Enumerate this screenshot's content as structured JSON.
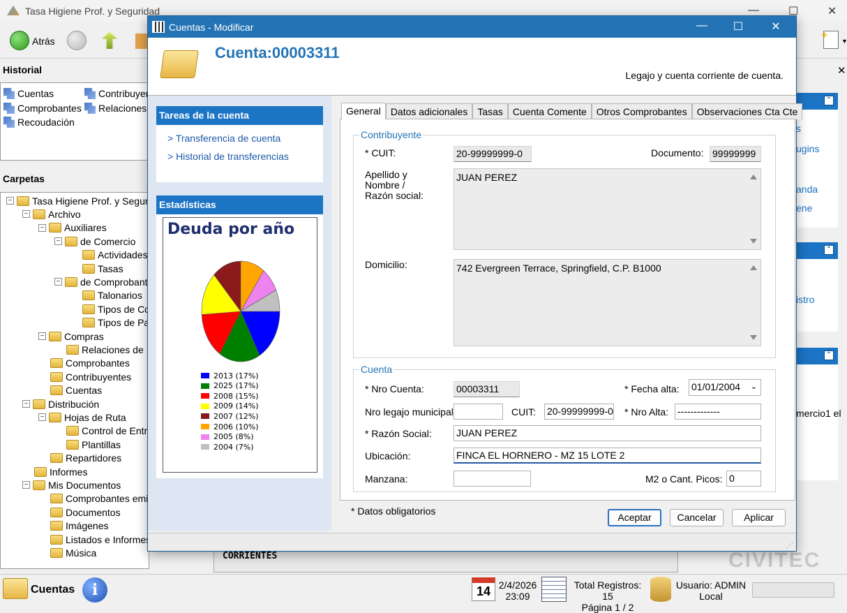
{
  "app": {
    "title": "Tasa Higiene Prof. y Seguridad",
    "back_label": "Atrás"
  },
  "historial": {
    "title": "Historial",
    "items": [
      "Cuentas",
      "Contribuyentes",
      "Comprobantes",
      "Relaciones de",
      "Recoudación"
    ]
  },
  "carpetas": {
    "title": "Carpetas",
    "tree": [
      {
        "label": "Tasa Higiene Prof. y Seguridad",
        "level": 0,
        "exp": "−"
      },
      {
        "label": "Archivo",
        "level": 1,
        "exp": "−"
      },
      {
        "label": "Auxiliares",
        "level": 2,
        "exp": "−"
      },
      {
        "label": "de Comercio",
        "level": 3,
        "exp": "−"
      },
      {
        "label": "Actividades",
        "level": 4,
        "exp": ""
      },
      {
        "label": "Tasas",
        "level": 4,
        "exp": ""
      },
      {
        "label": "de Comprobantes",
        "level": 3,
        "exp": "−"
      },
      {
        "label": "Talonarios",
        "level": 4,
        "exp": ""
      },
      {
        "label": "Tipos de Comprobantes",
        "level": 4,
        "exp": ""
      },
      {
        "label": "Tipos de Pago",
        "level": 4,
        "exp": ""
      },
      {
        "label": "Compras",
        "level": 2,
        "exp": "−"
      },
      {
        "label": "Relaciones de",
        "level": 3,
        "exp": ""
      },
      {
        "label": "Comprobantes",
        "level": 2,
        "exp": ""
      },
      {
        "label": "Contribuyentes",
        "level": 2,
        "exp": ""
      },
      {
        "label": "Cuentas",
        "level": 2,
        "exp": ""
      },
      {
        "label": "Distribución",
        "level": 1,
        "exp": "−"
      },
      {
        "label": "Hojas de Ruta",
        "level": 2,
        "exp": "−"
      },
      {
        "label": "Control de Entregas",
        "level": 3,
        "exp": ""
      },
      {
        "label": "Plantillas",
        "level": 3,
        "exp": ""
      },
      {
        "label": "Repartidores",
        "level": 2,
        "exp": ""
      },
      {
        "label": "Informes",
        "level": 1,
        "exp": ""
      },
      {
        "label": "Mis Documentos",
        "level": 1,
        "exp": "−"
      },
      {
        "label": "Comprobantes emitidos",
        "level": 2,
        "exp": ""
      },
      {
        "label": "Documentos",
        "level": 2,
        "exp": ""
      },
      {
        "label": "Imágenes",
        "level": 2,
        "exp": ""
      },
      {
        "label": "Listados e Informes",
        "level": 2,
        "exp": ""
      },
      {
        "label": "Música",
        "level": 2,
        "exp": ""
      }
    ]
  },
  "right_strip": {
    "links": [
      "s",
      "ugins",
      "anda",
      "ene",
      "istro",
      "mercio1 el"
    ]
  },
  "background_misc": {
    "corrientes": "CORRIENTES",
    "brand": "CIVITEC"
  },
  "bottom": {
    "title": "Cuentas",
    "date": "2/4/2026",
    "time": "23:09",
    "calendar_day": "14",
    "total_registros": "Total Registros: 15",
    "pagina": "Página 1 / 2",
    "usuario": "Usuario: ADMIN",
    "local": "Local"
  },
  "dialog": {
    "title": "Cuentas - Modificar",
    "heading": "Cuenta:00003311",
    "subheading": "Legajo y cuenta corriente de cuenta.",
    "tareas": {
      "title": "Tareas de la cuenta",
      "links": [
        "> Transferencia de cuenta",
        "> Historial de transferencias"
      ]
    },
    "estadisticas": {
      "title": "Estadísticas"
    },
    "tabs": [
      "General",
      "Datos adicionales",
      "Tasas",
      "Cuenta Comente",
      "Otros Comprobantes",
      "Observaciones Cta Cte"
    ],
    "contribuyente": {
      "group_title": "Contribuyente",
      "cuit_label": "* CUIT:",
      "cuit_value": "20-99999999-0",
      "documento_label": "Documento:",
      "documento_value": "99999999",
      "apellido_label": "Apellido y Nombre / Razón social:",
      "apellido_value": "JUAN PEREZ",
      "domicilio_label": "Domicilio:",
      "domicilio_value": "742 Evergreen Terrace, Springfield, C.P. B1000"
    },
    "cuenta": {
      "group_title": "Cuenta",
      "nro_cuenta_label": "* Nro Cuenta:",
      "nro_cuenta_value": "00003311",
      "fecha_alta_label": "* Fecha alta:",
      "fecha_alta_value": "01/01/2004",
      "legajo_label": "Nro legajo municipal:",
      "legajo_value": "",
      "cuit_label": "CUIT:",
      "cuit_value": "20-99999999-0",
      "nro_alta_label": "* Nro Alta:",
      "nro_alta_value": "-------------",
      "razon_social_label": "* Razón Social:",
      "razon_social_value": "JUAN PEREZ",
      "ubicacion_label": "Ubicación:",
      "ubicacion_value": "FINCA EL HORNERO - MZ 15 LOTE 2",
      "manzana_label": "Manzana:",
      "manzana_value": "",
      "m2_label": "M2 o Cant. Picos:",
      "m2_value": "0"
    },
    "footer_note": "* Datos obligatorios",
    "buttons": {
      "aceptar": "Aceptar",
      "cancelar": "Cancelar",
      "aplicar": "Aplicar"
    }
  },
  "chart_data": {
    "type": "pie",
    "title": "Deuda por año",
    "categories": [
      "2013",
      "2025",
      "2008",
      "2009",
      "2007",
      "2006",
      "2005",
      "2004"
    ],
    "values": [
      17,
      17,
      15,
      14,
      12,
      10,
      8,
      7
    ],
    "legend_labels": [
      "2013 (17%)",
      "2025 (17%)",
      "2008 (15%)",
      "2009 (14%)",
      "2007 (12%)",
      "2006 (10%)",
      "2005 (8%)",
      "2004 (7%)"
    ],
    "colors": [
      "#0000ff",
      "#008000",
      "#ff0000",
      "#ffff00",
      "#8b1a1a",
      "#ffa500",
      "#ee82ee",
      "#c0c0c0"
    ],
    "legend_placement": "bottom"
  }
}
